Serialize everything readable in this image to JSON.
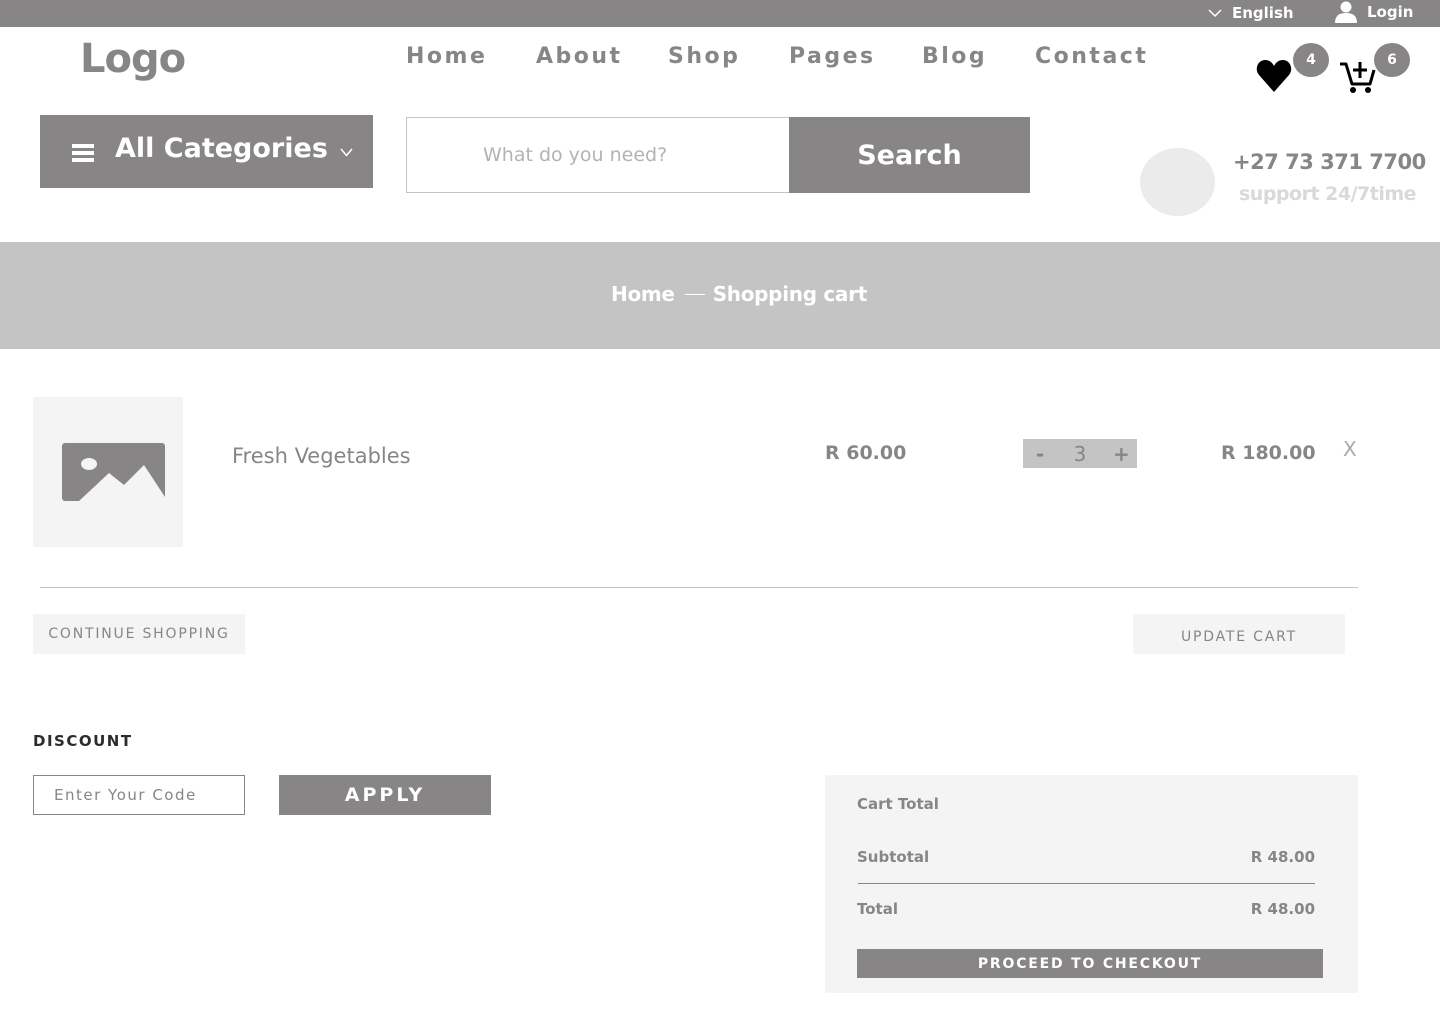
{
  "topbar": {
    "language": "English",
    "login": "Login"
  },
  "header": {
    "logo": "Logo",
    "nav": [
      {
        "label": "Home"
      },
      {
        "label": "About"
      },
      {
        "label": "Shop"
      },
      {
        "label": "Pages"
      },
      {
        "label": "Blog"
      },
      {
        "label": "Contact"
      }
    ],
    "wishlist_count": "4",
    "cart_count": "6"
  },
  "search": {
    "categories_label": "All Categories",
    "placeholder": "What do you need?",
    "button_label": "Search"
  },
  "contact": {
    "phone": "+27 73 371 7700",
    "support": "support 24/7time"
  },
  "breadcrumb": {
    "home": "Home",
    "current": "Shopping cart"
  },
  "cart": {
    "items": [
      {
        "name": "Fresh Vegetables",
        "price": "R 60.00",
        "quantity": "3",
        "total": "R 180.00",
        "remove": "X",
        "minus": "-",
        "plus": "+"
      }
    ],
    "continue_label": "CONTINUE SHOPPING",
    "update_label": "UPDATE CART"
  },
  "discount": {
    "title": "DISCOUNT",
    "placeholder": "Enter Your Code",
    "apply_label": "APPLY"
  },
  "totals": {
    "title": "Cart Total",
    "subtotal_label": "Subtotal",
    "subtotal_value": "R 48.00",
    "total_label": "Total",
    "total_value": "R 48.00",
    "checkout_label": "PROCEED TO CHECKOUT"
  },
  "colors": {
    "primary": "#878586",
    "light": "#f4f4f4",
    "band": "#c4c4c4"
  }
}
